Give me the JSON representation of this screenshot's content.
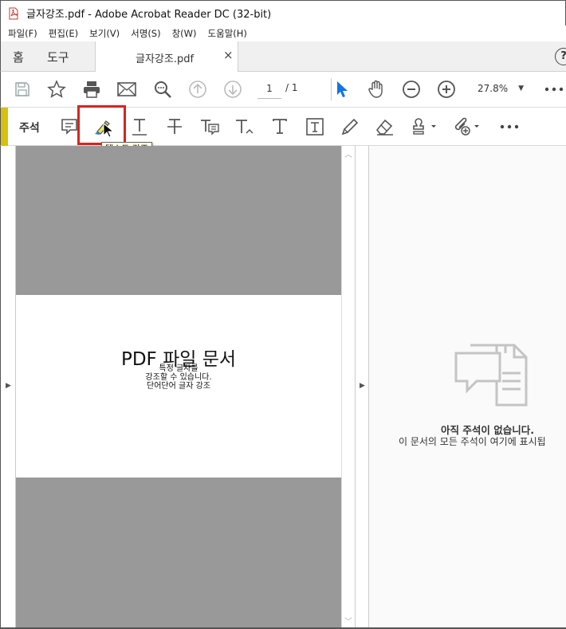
{
  "window": {
    "title": "글자강조.pdf - Adobe Acrobat Reader DC (32-bit)"
  },
  "menu": [
    "파일(F)",
    "편집(E)",
    "보기(V)",
    "서명(S)",
    "창(W)",
    "도움말(H)"
  ],
  "tabs": {
    "home": "홈",
    "tools": "도구",
    "document": "글자강조.pdf",
    "close": "×",
    "help": "?"
  },
  "toolbar": {
    "page_current": "1",
    "page_total": "/  1",
    "zoom": "27.8%",
    "icons": [
      "save-icon",
      "star-icon",
      "print-icon",
      "mail-icon",
      "search-zoom-icon",
      "page-up-icon",
      "page-down-icon",
      "select-cursor-icon",
      "hand-icon",
      "zoom-out-icon",
      "zoom-in-icon",
      "more-icon"
    ]
  },
  "comment_toolbar": {
    "label": "주석",
    "tooltip": "텍스트 강조",
    "accent_color": "#d8c010",
    "highlight_frame_color": "#d9231d"
  },
  "document": {
    "heading": "PDF 파일 문서",
    "lines": [
      "특정 글자를",
      "강조할 수 있습니다.",
      "단어단어 글자 강조"
    ]
  },
  "comments_panel": {
    "empty_title": "아직 주석이 없습니다.",
    "empty_subtitle": "이 문서의 모든 주석이 여기에 표시됩"
  }
}
